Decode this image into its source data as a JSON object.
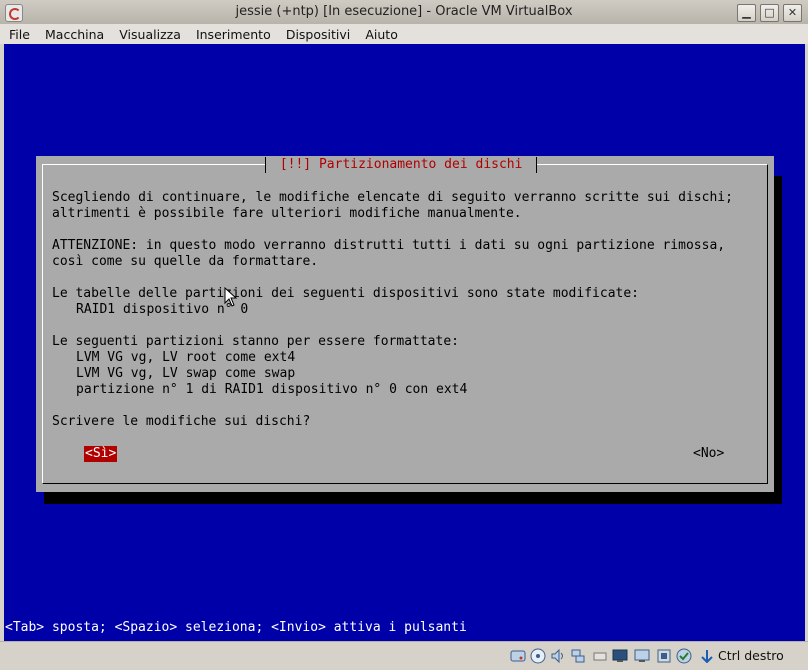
{
  "window": {
    "title": "jessie (+ntp) [In esecuzione] - Oracle VM VirtualBox",
    "buttons": [
      "▣",
      "□",
      "✕"
    ]
  },
  "menu": [
    "File",
    "Macchina",
    "Visualizza",
    "Inserimento",
    "Dispositivi",
    "Aiuto"
  ],
  "dialog": {
    "title": " [!!] Partizionamento dei dischi ",
    "lines": [
      "Scegliendo di continuare, le modifiche elencate di seguito verranno scritte sui dischi;",
      "altrimenti è possibile fare ulteriori modifiche manualmente.",
      "ATTENZIONE: in questo modo verranno distrutti tutti i dati su ogni partizione rimossa,",
      "così come su quelle da formattare.",
      "Le tabelle delle partizioni dei seguenti dispositivi sono state modificate:",
      "RAID1 dispositivo n° 0",
      "Le seguenti partizioni stanno per essere formattate:",
      "LVM VG vg, LV root come ext4",
      "LVM VG vg, LV swap come swap",
      "partizione n° 1 di RAID1 dispositivo n° 0 con ext4",
      "Scrivere le modifiche sui dischi?"
    ],
    "yes_button": "<Sì>",
    "no_button": "<No>"
  },
  "statusline": "<Tab> sposta; <Spazio> seleziona; <Invio> attiva i pulsanti",
  "statusbar": {
    "host_key": "Ctrl destro",
    "icons": [
      "hard-disk-icon",
      "optical-drive-icon",
      "audio-icon",
      "network-icon",
      "usb-icon",
      "shared-folders-icon",
      "display-icon",
      "video-capture-icon",
      "cpu-icon",
      "virtualization-icon",
      "mouse-integration-icon"
    ]
  }
}
